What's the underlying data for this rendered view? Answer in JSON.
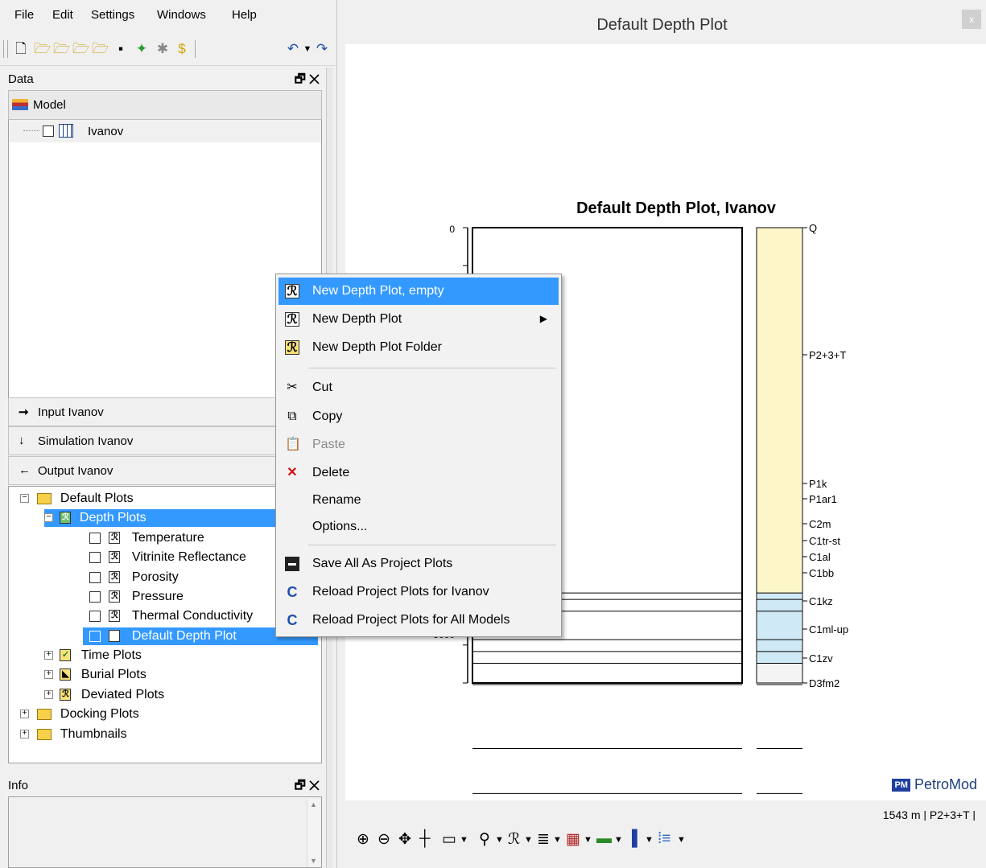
{
  "menubar": {
    "items": [
      "File",
      "Edit",
      "Settings",
      "Windows",
      "Help"
    ]
  },
  "data_panel": {
    "title": "Data",
    "controls": "🗗 ✕",
    "model_tab": "Model",
    "tree": [
      {
        "label": "Ivanov"
      }
    ]
  },
  "stack_buttons": {
    "input": "Input Ivanov",
    "simulation": "Simulation Ivanov",
    "output": "Output Ivanov"
  },
  "output_tree": {
    "default_plots": "Default Plots",
    "depth_plots": "Depth Plots",
    "depth_items": [
      "Temperature",
      "Vitrinite Reflectance",
      "Porosity",
      "Pressure",
      "Thermal Conductivity",
      "Default Depth Plot"
    ],
    "time_plots": "Time Plots",
    "burial_plots": "Burial Plots",
    "deviated_plots": "Deviated Plots",
    "docking_plots": "Docking Plots",
    "thumbnails": "Thumbnails"
  },
  "info_panel": {
    "title": "Info",
    "controls": "🗗 ✕"
  },
  "window": {
    "title": "Default Depth Plot",
    "close_label": "x"
  },
  "status": {
    "readout": "1543 m | P2+3+T |"
  },
  "logo": {
    "badge": "PM",
    "text": "PetroMod"
  },
  "context_menu": {
    "items": [
      {
        "label": "New Depth Plot, empty",
        "icon": "depth-plot-icon",
        "highlighted": true
      },
      {
        "label": "New Depth Plot",
        "icon": "depth-plot-icon",
        "submenu": true
      },
      {
        "label": "New Depth Plot Folder",
        "icon": "depth-plot-folder-icon"
      },
      {
        "label": "Cut",
        "icon": "scissors-icon"
      },
      {
        "label": "Copy",
        "icon": "copy-icon"
      },
      {
        "label": "Paste",
        "icon": "paste-icon",
        "disabled": true
      },
      {
        "label": "Delete",
        "icon": "delete-x-icon"
      },
      {
        "label": "Rename"
      },
      {
        "label": "Options..."
      },
      {
        "label": "Save All As Project Plots",
        "icon": "floppy-disk-icon"
      },
      {
        "label": "Reload Project Plots for Ivanov",
        "icon": "reload-c-icon"
      },
      {
        "label": "Reload Project Plots for All Models",
        "icon": "reload-c-icon"
      }
    ]
  },
  "chart_data": {
    "type": "table",
    "title": "Default Depth Plot, Ivanov",
    "y_tick_labels": [
      "0",
      "5000"
    ],
    "ylim": [
      0,
      5000
    ],
    "y_inverted": true,
    "layers": [
      {
        "name": "Q",
        "top": 0,
        "base": 0,
        "color": "#fffbe0"
      },
      {
        "name": "P2+3+T",
        "top": 0,
        "base": 1543,
        "color": "#fdf6c9"
      },
      {
        "name": "P1k",
        "top": 1543,
        "base": 1570,
        "color": "#cfe9f6"
      },
      {
        "name": "P1ar1",
        "top": 1570,
        "base": 1620,
        "color": "#cfe9f6"
      },
      {
        "name": "C2m",
        "top": 1620,
        "base": 1740,
        "color": "#cfe9f6"
      },
      {
        "name": "C1tr-st",
        "top": 1740,
        "base": 1790,
        "color": "#cfe9f6"
      },
      {
        "name": "C1al",
        "top": 1790,
        "base": 1840,
        "color": "#cfe9f6"
      },
      {
        "name": "C1bb",
        "top": 1840,
        "base": 1930,
        "color": "#f4f4f4"
      },
      {
        "name": "C1kz",
        "top": 1930,
        "base": 2200,
        "color": "#cfe9f6"
      },
      {
        "name": "C1ml-up",
        "top": 2200,
        "base": 2390,
        "color": "#cfe9f6"
      },
      {
        "name": "C1zv",
        "top": 2390,
        "base": 2600,
        "color": "#cfe9f6"
      },
      {
        "name": "D3fm2",
        "top": 2600,
        "base": 2600,
        "color": "#cfe9f6"
      }
    ]
  }
}
